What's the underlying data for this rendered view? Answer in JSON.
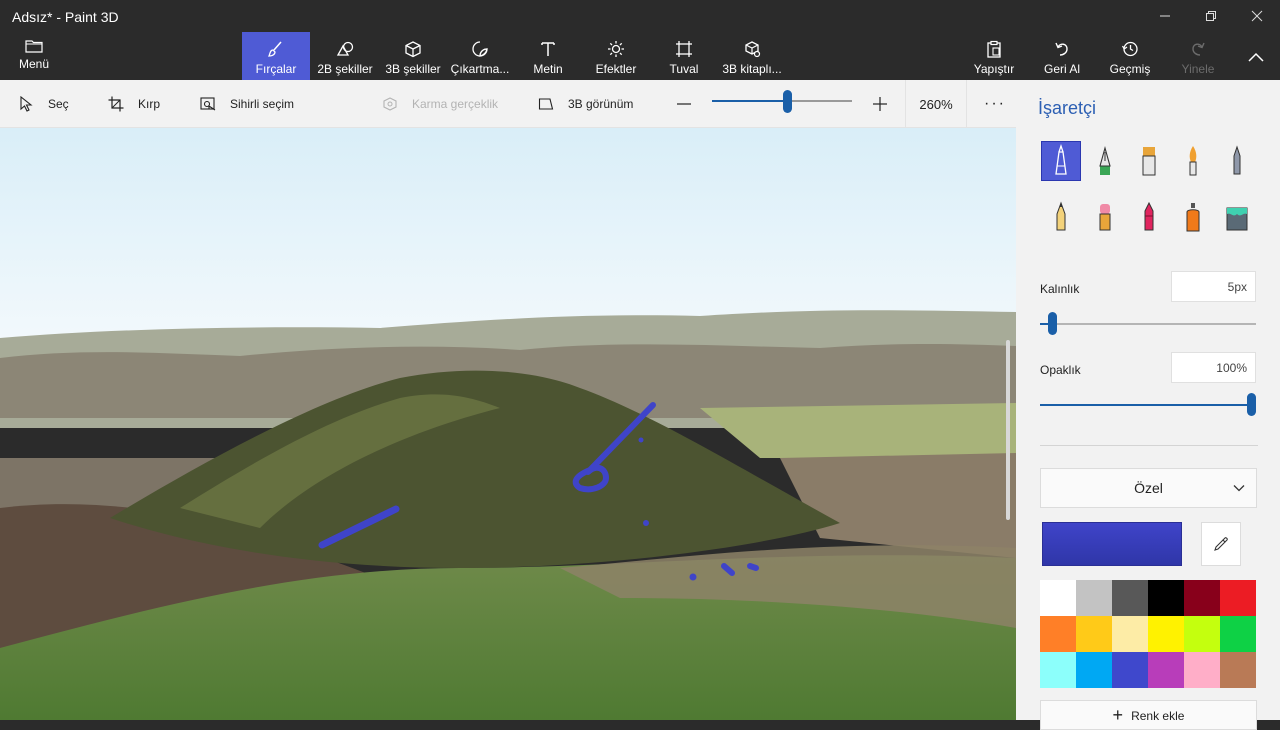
{
  "window": {
    "title": "Adsız* - Paint 3D"
  },
  "ribbon": {
    "menu_label": "Menü",
    "tools": [
      {
        "label": "Fırçalar",
        "icon": "brush-icon",
        "active": true
      },
      {
        "label": "2B şekiller",
        "icon": "shapes-2d-icon"
      },
      {
        "label": "3B şekiller",
        "icon": "cube-icon"
      },
      {
        "label": "Çıkartma...",
        "icon": "sticker-icon"
      },
      {
        "label": "Metin",
        "icon": "text-icon"
      },
      {
        "label": "Efektler",
        "icon": "sun-icon"
      },
      {
        "label": "Tuval",
        "icon": "canvas-icon"
      },
      {
        "label": "3B kitaplı...",
        "icon": "library-3d-icon"
      }
    ],
    "actions": [
      {
        "label": "Yapıştır",
        "icon": "paste-icon"
      },
      {
        "label": "Geri Al",
        "icon": "undo-icon"
      },
      {
        "label": "Geçmiş",
        "icon": "history-icon"
      },
      {
        "label": "Yinele",
        "icon": "redo-icon",
        "disabled": true
      }
    ]
  },
  "toolbar2": {
    "select": "Seç",
    "crop": "Kırp",
    "magic_select": "Sihirli seçim",
    "mixed_reality": "Karma gerçeklik",
    "view3d": "3B görünüm",
    "zoom_value": "260%",
    "zoom_level_fraction": 0.54
  },
  "panel": {
    "title": "İşaretçi",
    "brushes": [
      {
        "name": "marker-brush",
        "selected": true
      },
      {
        "name": "calligraphy-pen-brush"
      },
      {
        "name": "oil-brush"
      },
      {
        "name": "watercolor-brush"
      },
      {
        "name": "pixel-pen-brush"
      },
      {
        "name": "pencil-brush"
      },
      {
        "name": "eraser-brush"
      },
      {
        "name": "crayon-brush"
      },
      {
        "name": "spray-can-brush"
      },
      {
        "name": "fill-bucket-brush"
      }
    ],
    "thickness_label": "Kalınlık",
    "thickness_value": "5px",
    "thickness_fraction": 0.05,
    "opacity_label": "Opaklık",
    "opacity_value": "100%",
    "opacity_fraction": 1.0,
    "color_mode": "Özel",
    "current_color": "#3f44c9",
    "palette": [
      "#ffffff",
      "#c3c3c3",
      "#585858",
      "#000000",
      "#88001b",
      "#ec1c24",
      "#ff7f27",
      "#ffca18",
      "#fdeca6",
      "#fff200",
      "#c4ff0e",
      "#0ed145",
      "#8cfffb",
      "#00a8f3",
      "#3f48cc",
      "#b83dba",
      "#ffaec8",
      "#b97a56"
    ],
    "add_color_label": "Renk ekle"
  },
  "colors": {
    "accent": "#4f5bd5",
    "ribbon_bg": "#2b2b2b",
    "slider": "#1a5fa8"
  }
}
